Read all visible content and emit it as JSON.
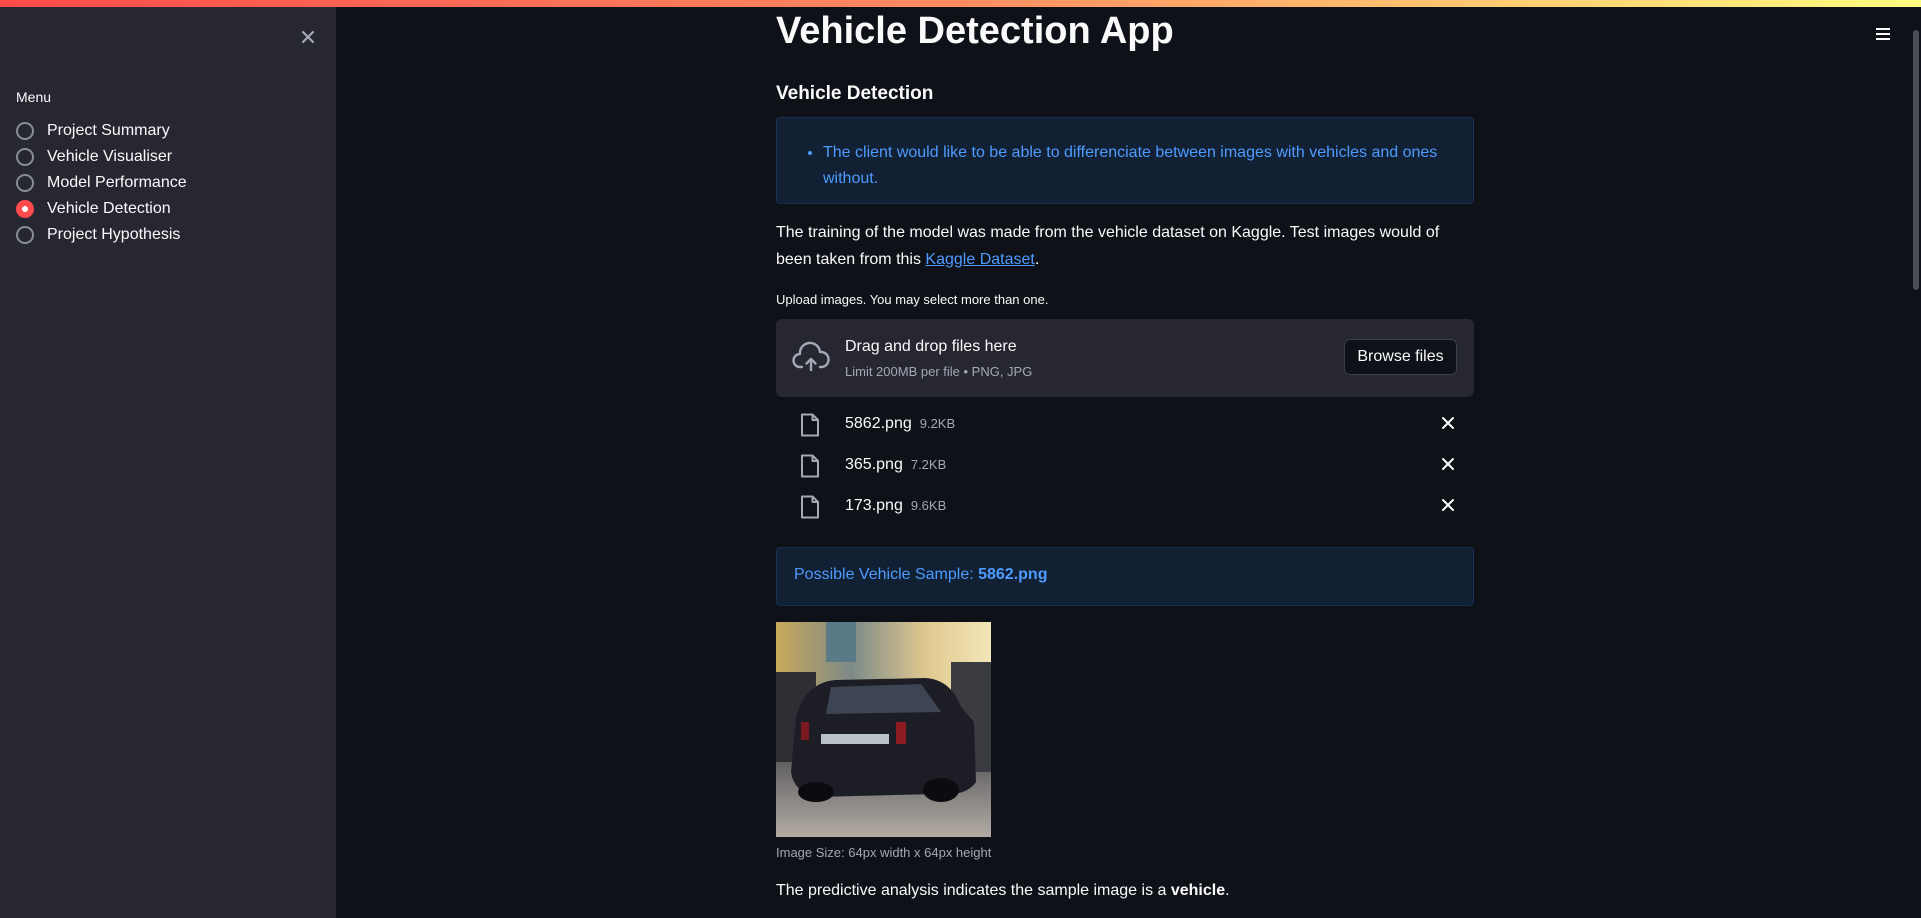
{
  "sidebar": {
    "menu_label": "Menu",
    "items": [
      {
        "label": "Project Summary",
        "selected": false
      },
      {
        "label": "Vehicle Visualiser",
        "selected": false
      },
      {
        "label": "Model Performance",
        "selected": false
      },
      {
        "label": "Vehicle Detection",
        "selected": true
      },
      {
        "label": "Project Hypothesis",
        "selected": false
      }
    ]
  },
  "main": {
    "title": "Vehicle Detection App",
    "section_title": "Vehicle Detection",
    "info_bullet": "The client would like to be able to differenciate between images with vehicles and ones without.",
    "description_prefix": "The training of the model was made from the vehicle dataset on Kaggle. Test images would of been taken from this ",
    "description_link": "Kaggle Dataset",
    "description_suffix": ".",
    "upload": {
      "label": "Upload images. You may select more than one.",
      "drop_title": "Drag and drop files here",
      "drop_subtitle": "Limit 200MB per file • PNG, JPG",
      "browse_label": "Browse files"
    },
    "files": [
      {
        "name": "5862.png",
        "size": "9.2KB"
      },
      {
        "name": "365.png",
        "size": "7.2KB"
      },
      {
        "name": "173.png",
        "size": "9.6KB"
      }
    ],
    "result": {
      "prefix": "Possible Vehicle Sample: ",
      "filename": "5862.png"
    },
    "image_caption": "Image Size: 64px width x 64px height",
    "prediction": {
      "prefix": "The predictive analysis indicates the sample image is a ",
      "label": "vehicle",
      "suffix": "."
    }
  },
  "colors": {
    "accent": "#ff4b4b",
    "info_text": "#4e9bff",
    "background": "#0e1117",
    "sidebar": "#262730"
  }
}
